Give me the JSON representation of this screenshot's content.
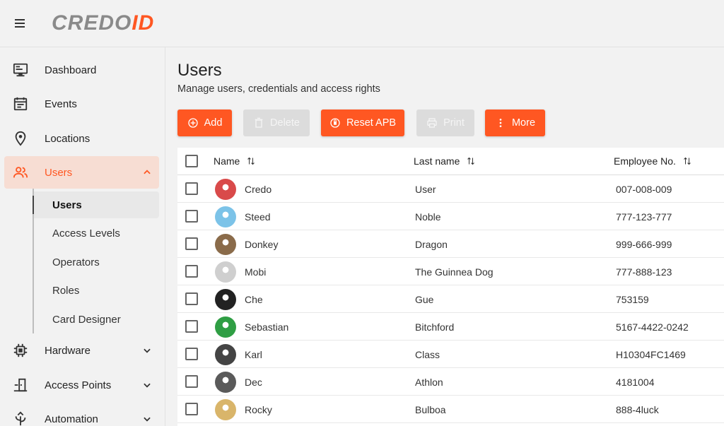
{
  "app": {
    "logo_text_grey": "CREDO",
    "logo_text_orange": "ID",
    "brand_color": "#ff5722",
    "grey_color": "#8a8a8a"
  },
  "sidebar": {
    "items": [
      {
        "label": "Dashboard",
        "icon": "monitor-icon"
      },
      {
        "label": "Events",
        "icon": "calendar-icon"
      },
      {
        "label": "Locations",
        "icon": "location-pin-icon"
      },
      {
        "label": "Users",
        "icon": "users-icon",
        "active": true,
        "expanded": true
      },
      {
        "label": "Hardware",
        "icon": "chip-icon"
      },
      {
        "label": "Access Points",
        "icon": "door-icon"
      },
      {
        "label": "Automation",
        "icon": "automation-icon"
      }
    ],
    "sub_items": [
      {
        "label": "Users",
        "active": true
      },
      {
        "label": "Access Levels"
      },
      {
        "label": "Operators"
      },
      {
        "label": "Roles"
      },
      {
        "label": "Card Designer"
      }
    ]
  },
  "page": {
    "title": "Users",
    "subtitle": "Manage users, credentials and access rights"
  },
  "toolbar": {
    "add": "Add",
    "delete": "Delete",
    "reset_apb": "Reset APB",
    "print": "Print",
    "more": "More"
  },
  "table": {
    "columns": [
      "Name",
      "Last name",
      "Employee No."
    ],
    "rows": [
      {
        "name": "Credo",
        "last": "User",
        "emp": "007-008-009",
        "avatar": "#d94a4a"
      },
      {
        "name": "Steed",
        "last": "Noble",
        "emp": "777-123-777",
        "avatar": "#7cc3e8"
      },
      {
        "name": "Donkey",
        "last": "Dragon",
        "emp": "999-666-999",
        "avatar": "#8a6b4a"
      },
      {
        "name": "Mobi",
        "last": "The Guinnea Dog",
        "emp": "777-888-123",
        "avatar": "#cfcfcf"
      },
      {
        "name": "Che",
        "last": "Gue",
        "emp": "753159",
        "avatar": "#222222"
      },
      {
        "name": "Sebastian",
        "last": "Bitchford",
        "emp": "5167-4422-0242",
        "avatar": "#2f9e44"
      },
      {
        "name": "Karl",
        "last": "Class",
        "emp": "H10304FC1469",
        "avatar": "#444444"
      },
      {
        "name": "Dec",
        "last": "Athlon",
        "emp": "4181004",
        "avatar": "#5a5a5a"
      },
      {
        "name": "Rocky",
        "last": "Bulboa",
        "emp": "888-4luck",
        "avatar": "#d9b56a"
      }
    ]
  }
}
